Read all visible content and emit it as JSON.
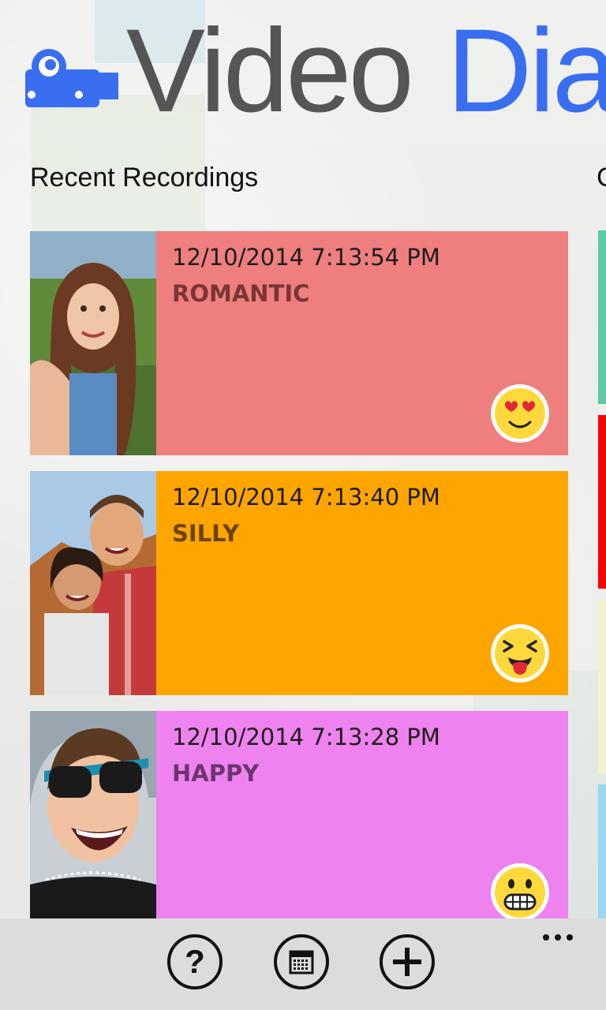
{
  "app": {
    "title_word_1": "Video",
    "title_word_2": "Dia",
    "title_color_1": "#555555",
    "title_color_2": "#3a6ef0",
    "logo_icon": "video-camera-icon"
  },
  "sections": {
    "recent_title": "Recent Recordings",
    "next_section_peek": "C"
  },
  "recordings": [
    {
      "datetime": "12/10/2014 7:13:54 PM",
      "mood": "ROMANTIC",
      "color": "#ef7e7e",
      "mood_color": "#7a3535",
      "emoji": "heart-eyes-emoji-icon",
      "thumbnail": "woman-selfie-photo"
    },
    {
      "datetime": "12/10/2014 7:13:40 PM",
      "mood": "SILLY",
      "color": "#ffa500",
      "mood_color": "#6b4500",
      "emoji": "tongue-out-emoji-icon",
      "thumbnail": "couple-selfie-photo"
    },
    {
      "datetime": "12/10/2014 7:13:28 PM",
      "mood": "HAPPY",
      "color": "#ee82ee",
      "mood_color": "#6d3570",
      "emoji": "grinning-emoji-icon",
      "thumbnail": "woman-sunglasses-photo"
    }
  ],
  "side_strips": [
    {
      "color": "#5cc9a7"
    },
    {
      "color": "#ff0000"
    },
    {
      "color": "#f3f1cf"
    },
    {
      "color": "#9ad7ee"
    }
  ],
  "appbar": {
    "help_icon": "help-icon",
    "help_glyph": "?",
    "calendar_icon": "calendar-icon",
    "add_icon": "add-icon",
    "add_glyph": "+",
    "more_icon": "more-options-icon"
  }
}
